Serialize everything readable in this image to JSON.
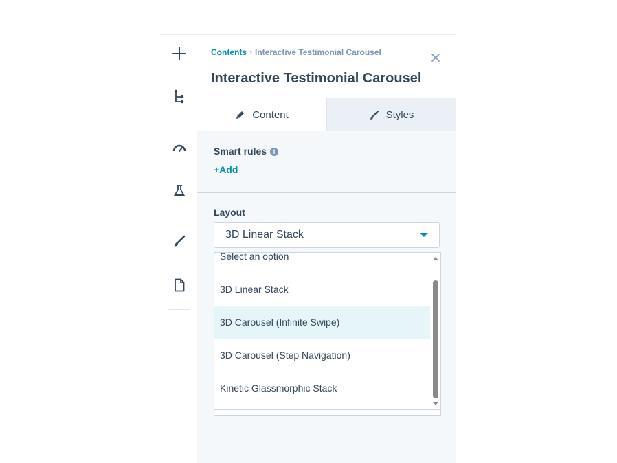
{
  "breadcrumb": {
    "root": "Contents",
    "separator": "›",
    "current": "Interactive Testimonial Carousel"
  },
  "panel": {
    "title": "Interactive Testimonial Carousel"
  },
  "tabs": [
    {
      "label": "Content",
      "icon": "pencil-icon",
      "active": true
    },
    {
      "label": "Styles",
      "icon": "brush-icon",
      "active": false
    }
  ],
  "smart_rules": {
    "label": "Smart rules",
    "info_icon": "i",
    "add_label": "+Add"
  },
  "layout": {
    "label": "Layout",
    "selected": "3D Linear Stack",
    "options": [
      "Select an option",
      "3D Linear Stack",
      "3D Carousel (Infinite Swipe)",
      "3D Carousel (Step Navigation)",
      "Kinetic Glassmorphic Stack"
    ],
    "highlighted_index": 2
  },
  "toolbar": {
    "icons": [
      "plus-icon",
      "tree-icon",
      "gauge-icon",
      "flask-icon",
      "brush-icon",
      "document-icon"
    ]
  },
  "colors": {
    "accent": "#0091ae",
    "text": "#33475b",
    "panel_bg": "#f5f8fa",
    "highlight": "#e5f5f8"
  }
}
